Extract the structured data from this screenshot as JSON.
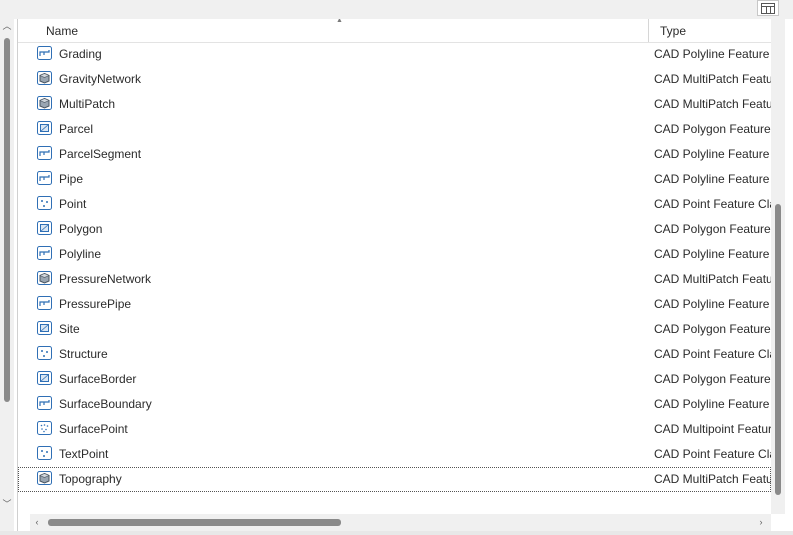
{
  "columns": {
    "name": "Name",
    "type": "Type"
  },
  "rows": [
    {
      "name": "Grading",
      "type": "CAD Polyline Feature Class",
      "icon": "polyline-icon"
    },
    {
      "name": "GravityNetwork",
      "type": "CAD MultiPatch Feature Class",
      "icon": "multipatch-icon"
    },
    {
      "name": "MultiPatch",
      "type": "CAD MultiPatch Feature Class",
      "icon": "multipatch-icon"
    },
    {
      "name": "Parcel",
      "type": "CAD Polygon Feature Class",
      "icon": "polygon-icon"
    },
    {
      "name": "ParcelSegment",
      "type": "CAD Polyline Feature Class",
      "icon": "polyline-icon"
    },
    {
      "name": "Pipe",
      "type": "CAD Polyline Feature Class",
      "icon": "polyline-icon"
    },
    {
      "name": "Point",
      "type": "CAD Point Feature Class",
      "icon": "point-icon"
    },
    {
      "name": "Polygon",
      "type": "CAD Polygon Feature Class",
      "icon": "polygon-icon"
    },
    {
      "name": "Polyline",
      "type": "CAD Polyline Feature Class",
      "icon": "polyline-icon"
    },
    {
      "name": "PressureNetwork",
      "type": "CAD MultiPatch Feature Class",
      "icon": "multipatch-icon"
    },
    {
      "name": "PressurePipe",
      "type": "CAD Polyline Feature Class",
      "icon": "polyline-icon"
    },
    {
      "name": "Site",
      "type": "CAD Polygon Feature Class",
      "icon": "polygon-icon"
    },
    {
      "name": "Structure",
      "type": "CAD Point Feature Class",
      "icon": "point-icon"
    },
    {
      "name": "SurfaceBorder",
      "type": "CAD Polygon Feature Class",
      "icon": "polygon-icon"
    },
    {
      "name": "SurfaceBoundary",
      "type": "CAD Polyline Feature Class",
      "icon": "polyline-icon"
    },
    {
      "name": "SurfacePoint",
      "type": "CAD Multipoint Feature Class",
      "icon": "multipoint-icon"
    },
    {
      "name": "TextPoint",
      "type": "CAD Point Feature Class",
      "icon": "point-icon"
    },
    {
      "name": "Topography",
      "type": "CAD MultiPatch Feature Class",
      "icon": "multipatch-icon"
    }
  ],
  "focused_row": "Topography",
  "sort": {
    "column": "Name",
    "direction": "ascending"
  },
  "colors": {
    "icon_blue": "#2f6fb5",
    "scroll_thumb": "#8a8a8a"
  }
}
